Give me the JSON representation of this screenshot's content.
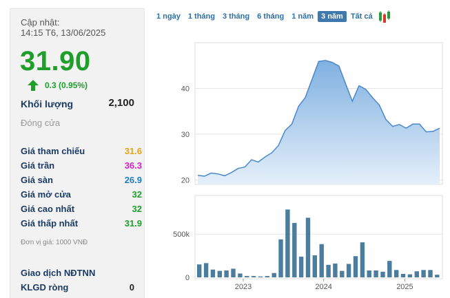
{
  "info": {
    "updated_label": "Cập nhật:",
    "updated_time": "14:15 T6, 13/06/2025",
    "price": "31.90",
    "change": "0.3 (0.95%)",
    "volume_label": "Khối lượng",
    "volume_value": "2,100",
    "closed_status": "Đóng cửa",
    "rows": [
      {
        "label": "Giá tham chiếu",
        "value": "31.6",
        "color": "#e6a317"
      },
      {
        "label": "Giá trần",
        "value": "36.3",
        "color": "#d61fc9"
      },
      {
        "label": "Giá sàn",
        "value": "26.9",
        "color": "#1f7fbf"
      },
      {
        "label": "Giá mở cửa",
        "value": "32",
        "color": "#1f9e2b"
      },
      {
        "label": "Giá cao nhất",
        "value": "32",
        "color": "#1f9e2b"
      },
      {
        "label": "Giá thấp nhất",
        "value": "31.9",
        "color": "#1f9e2b"
      }
    ],
    "unit_note": "Đơn vị giá: 1000 VNĐ",
    "foreign_label": "Giao dịch NĐTNN",
    "net_volume_label": "KLGD ròng",
    "net_volume_value": "0"
  },
  "tabs": [
    {
      "label": "1 ngày",
      "active": false
    },
    {
      "label": "1 tháng",
      "active": false
    },
    {
      "label": "3 tháng",
      "active": false
    },
    {
      "label": "6 tháng",
      "active": false
    },
    {
      "label": "1 năm",
      "active": false
    },
    {
      "label": "3 năm",
      "active": true
    },
    {
      "label": "Tất cả",
      "active": false
    }
  ],
  "chart_data": [
    {
      "type": "area",
      "x": [
        0,
        1,
        2,
        3,
        4,
        5,
        6,
        7,
        8,
        9,
        10,
        11,
        12,
        13,
        14,
        15,
        16,
        17,
        18,
        19,
        20,
        21,
        22,
        23,
        24,
        25,
        26,
        27,
        28,
        29,
        30,
        31,
        32,
        33,
        34,
        35
      ],
      "values": [
        21.0,
        20.8,
        21.5,
        21.3,
        20.9,
        21.6,
        22.5,
        22.8,
        24.4,
        23.9,
        25.0,
        25.9,
        27.5,
        30.8,
        32.2,
        36.1,
        38.0,
        42.0,
        45.9,
        46.1,
        45.7,
        44.9,
        41.0,
        37.2,
        40.6,
        39.8,
        38.0,
        36.4,
        33.2,
        31.7,
        32.1,
        31.3,
        32.2,
        32.2,
        30.5,
        30.6,
        31.3
      ],
      "yticks": [
        20,
        30,
        40
      ],
      "ylim": [
        19,
        50
      ],
      "color": "#4a87c9",
      "fill_top": "#7fb0e0",
      "fill_bottom": "#e4effa"
    },
    {
      "type": "bar",
      "values": [
        150000,
        165000,
        90000,
        75000,
        80000,
        100000,
        45000,
        15000,
        15000,
        10000,
        15000,
        50000,
        440000,
        785000,
        630000,
        240000,
        690000,
        255000,
        385000,
        145000,
        160000,
        75000,
        155000,
        245000,
        405000,
        80000,
        80000,
        65000,
        190000,
        85000,
        40000,
        35000,
        70000,
        85000,
        85000,
        30000
      ],
      "yticks": [
        0,
        500000
      ],
      "ytick_labels": [
        "0",
        "500k"
      ],
      "ylim": [
        0,
        900000
      ],
      "xtick_labels": [
        "2023",
        "2024",
        "2025"
      ],
      "color": "#4b7d9e"
    }
  ]
}
